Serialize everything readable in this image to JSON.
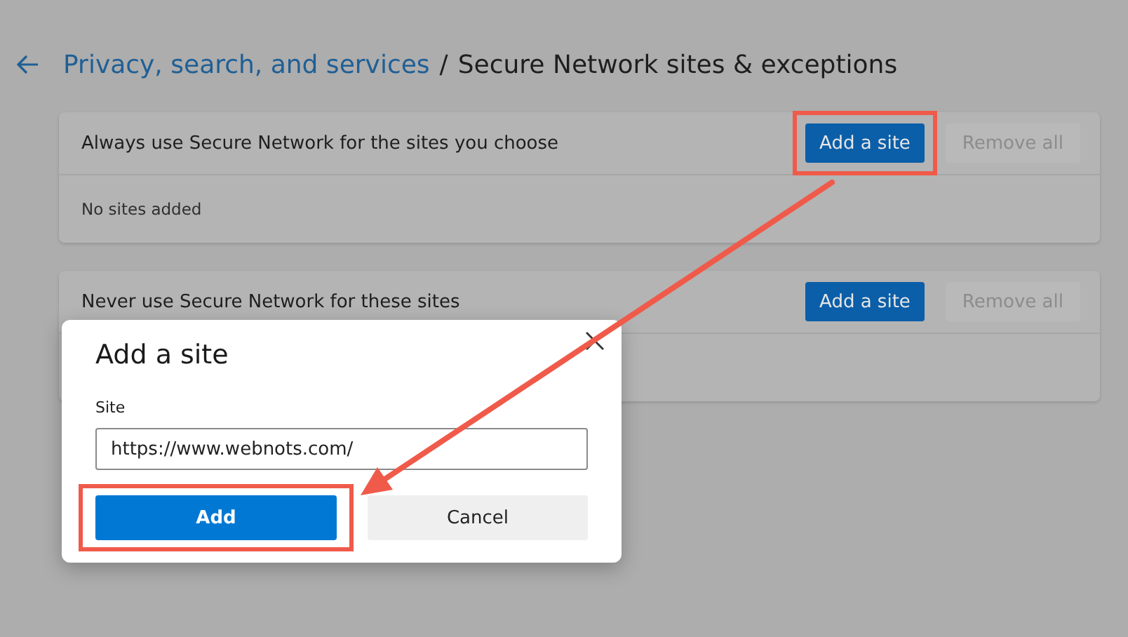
{
  "breadcrumb": {
    "parent": "Privacy, search, and services",
    "separator": "/",
    "current": "Secure Network sites & exceptions"
  },
  "sections": [
    {
      "title": "Always use Secure Network for the sites you choose",
      "add_button": "Add a site",
      "add_highlighted": true,
      "remove_button": "Remove all",
      "remove_disabled": true,
      "empty_text": "No sites added"
    },
    {
      "title": "Never use Secure Network for these sites",
      "add_button": "Add a site",
      "add_highlighted": false,
      "remove_button": "Remove all",
      "remove_disabled": true
    }
  ],
  "dialog": {
    "title": "Add a site",
    "field_label": "Site",
    "field_value": "https://www.webnots.com/",
    "primary_button": "Add",
    "primary_highlighted": true,
    "secondary_button": "Cancel"
  }
}
